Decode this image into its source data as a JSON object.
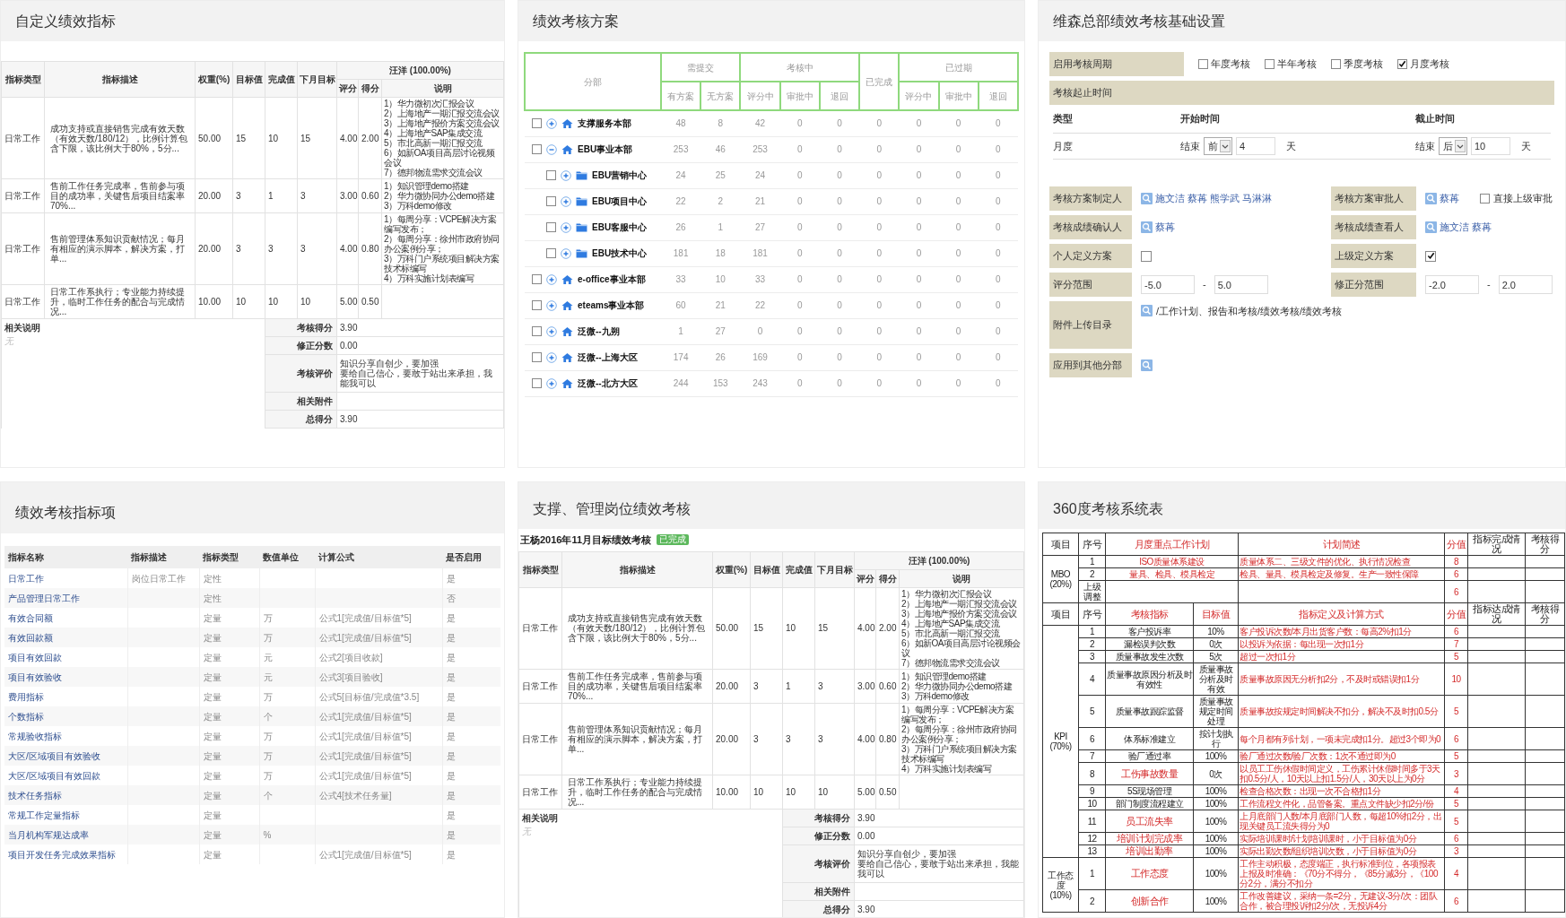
{
  "custom_indicators": {
    "title": "自定义绩效指标",
    "table": {
      "columns": [
        "指标类型",
        "指标描述",
        "权重(%)",
        "目标值",
        "完成值",
        "下月目标"
      ],
      "reviewer": "汪洋 (100.00%)",
      "sub_columns": [
        "评分",
        "得分",
        "说明"
      ],
      "rows": [
        {
          "type": "日常工作",
          "description": "成功支持或直接销售完成有效天数（有效天数/180/12），比例计算包含下限，该比例大于80%，5分...",
          "weight": "50.00",
          "target": "15",
          "actual": "10",
          "next_target": "15",
          "rating": "4.00",
          "score": "2.00",
          "notes": [
            "1）华力微初次汇报会议",
            "2）上海地产一期汇报交流会议",
            "3）上海地产报价方案交流会议",
            "4）上海地产SAP集成交流",
            "5）市北高新一期汇报交流",
            "6）如新OA项目高层讨论视频会议",
            "7）德邦物流需求交流会议"
          ]
        },
        {
          "type": "日常工作",
          "description": "售前工作任务完成率，售前参与项目的成功率，关键售后项目结案率70%...",
          "weight": "20.00",
          "target": "3",
          "actual": "1",
          "next_target": "3",
          "rating": "3.00",
          "score": "0.60",
          "notes": [
            "1）知识管理demo搭建",
            "2）华力微协同办公demo搭建",
            "3）万科demo修改"
          ]
        },
        {
          "type": "日常工作",
          "description": "售前管理体系知识贡献情况；每月有相应的演示脚本，解决方案，打单...",
          "weight": "20.00",
          "target": "3",
          "actual": "3",
          "next_target": "3",
          "rating": "4.00",
          "score": "0.80",
          "notes": [
            "1）每周分享：VCPE解决方案编写发布；",
            "2）每周分享：徐州市政府协同办公案例分享；",
            "3）万科门户系统项目解决方案技术标编写",
            "4）万科实施计划表编写"
          ]
        },
        {
          "type": "日常工作",
          "description": "日常工作系执行；专业能力持续提升，临时工作任务的配合与完成情况...",
          "weight": "10.00",
          "target": "10",
          "actual": "10",
          "next_target": "10",
          "rating": "5.00",
          "score": "0.50"
        }
      ],
      "remarks_label": "相关说明",
      "remarks": "无",
      "summary": [
        {
          "label": "考核得分",
          "value": "3.90"
        },
        {
          "label": "修正分数",
          "value": "0.00"
        },
        {
          "label": "考核评价",
          "lines": [
            "知识分享自创少，要加强",
            "要给自己信心，要敢于站出来承担，我能我可以"
          ]
        },
        {
          "label": "相关附件"
        },
        {
          "label": "总得分",
          "value": "3.90"
        }
      ]
    }
  },
  "assessment_plans": {
    "title": "绩效考核方案",
    "columns": [
      {
        "label": "分部"
      },
      {
        "label": "需提交",
        "sub": [
          "有方案",
          "无方案"
        ]
      },
      {
        "label": "考核中",
        "sub": [
          "评分中",
          "审批中",
          "退回"
        ]
      },
      {
        "label": "已完成"
      },
      {
        "label": "已过期",
        "sub": [
          "评分中",
          "审批中",
          "退回"
        ]
      }
    ],
    "rows": [
      {
        "name": "支撑服务本部",
        "checked": false,
        "expanded": false,
        "values": [
          "48",
          "8",
          "42",
          "0",
          "0",
          "0",
          "0",
          "0",
          "0"
        ]
      },
      {
        "name": "EBU事业本部",
        "checked": false,
        "expanded": true,
        "values": [
          "253",
          "46",
          "253",
          "0",
          "0",
          "0",
          "0",
          "0",
          "0"
        ],
        "children": [
          {
            "name": "EBU营销中心",
            "checked": false,
            "expanded": false,
            "values": [
              "24",
              "25",
              "24",
              "0",
              "0",
              "0",
              "0",
              "0",
              "0"
            ]
          },
          {
            "name": "EBU项目中心",
            "checked": false,
            "expanded": false,
            "values": [
              "22",
              "2",
              "21",
              "0",
              "0",
              "0",
              "0",
              "0",
              "0"
            ]
          },
          {
            "name": "EBU客服中心",
            "checked": false,
            "expanded": false,
            "values": [
              "26",
              "1",
              "27",
              "0",
              "0",
              "0",
              "0",
              "0",
              "0"
            ]
          },
          {
            "name": "EBU技术中心",
            "checked": false,
            "expanded": false,
            "values": [
              "181",
              "18",
              "181",
              "0",
              "0",
              "0",
              "0",
              "0",
              "0"
            ]
          }
        ]
      },
      {
        "name": "e-office事业本部",
        "checked": false,
        "expanded": false,
        "values": [
          "33",
          "10",
          "33",
          "0",
          "0",
          "0",
          "0",
          "0",
          "0"
        ]
      },
      {
        "name": "eteams事业本部",
        "checked": false,
        "expanded": false,
        "values": [
          "60",
          "21",
          "22",
          "0",
          "0",
          "0",
          "0",
          "0",
          "0"
        ]
      },
      {
        "name": "泛微--九朔",
        "checked": false,
        "expanded": false,
        "values": [
          "1",
          "27",
          "0",
          "0",
          "0",
          "0",
          "0",
          "0",
          "0"
        ]
      },
      {
        "name": "泛微--上海大区",
        "checked": false,
        "expanded": false,
        "values": [
          "174",
          "26",
          "169",
          "0",
          "0",
          "0",
          "0",
          "0",
          "0"
        ]
      },
      {
        "name": "泛微--北方大区",
        "checked": false,
        "expanded": false,
        "values": [
          "244",
          "153",
          "243",
          "0",
          "0",
          "0",
          "0",
          "0",
          "0"
        ]
      }
    ]
  },
  "basic_settings": {
    "title": "维森总部绩效考核基础设置",
    "cycle": {
      "label": "启用考核周期",
      "options": [
        {
          "label": "年度考核",
          "checked": false
        },
        {
          "label": "半年考核",
          "checked": false
        },
        {
          "label": "季度考核",
          "checked": false
        },
        {
          "label": "月度考核",
          "checked": true
        }
      ]
    },
    "period_label": "考核起止时间",
    "period_columns": [
      "类型",
      "开始时间",
      "截止时间"
    ],
    "period_rows": [
      {
        "type": "月度",
        "start": {
          "prefix": "结束",
          "direction": "前",
          "days": "4",
          "unit": "天"
        },
        "end": {
          "prefix": "结束",
          "direction": "后",
          "days": "10",
          "unit": "天"
        }
      }
    ],
    "fields": [
      [
        {
          "label": "考核方案制定人",
          "kind": "people",
          "people": [
            "施文洁",
            "蔡苒",
            "熊学武",
            "马淋淋"
          ]
        },
        {
          "label": "考核方案审批人",
          "kind": "people",
          "people": [
            "蔡苒"
          ],
          "option": {
            "label": "直接上级审批",
            "checked": false
          }
        }
      ],
      [
        {
          "label": "考核成绩确认人",
          "kind": "people",
          "people": [
            "蔡苒"
          ]
        },
        {
          "label": "考核成绩查看人",
          "kind": "people",
          "people": [
            "施文洁",
            "蔡苒"
          ]
        }
      ],
      [
        {
          "label": "个人定义方案",
          "kind": "checkbox",
          "checked": false
        },
        {
          "label": "上级定义方案",
          "kind": "checkbox",
          "checked": true
        }
      ],
      [
        {
          "label": "评分范围",
          "kind": "range",
          "from": "-5.0",
          "separator": "-",
          "to": "5.0"
        },
        {
          "label": "修正分范围",
          "kind": "range",
          "from": "-2.0",
          "separator": "-",
          "to": "2.0"
        }
      ],
      [
        {
          "label": "附件上传目录",
          "kind": "path",
          "path": "/工作计划、报告和考核/绩效考核/绩效考核"
        }
      ],
      [
        {
          "label": "应用到其他分部",
          "kind": "lookup"
        }
      ]
    ]
  },
  "indicator_items": {
    "title": "绩效考核指标项",
    "columns": [
      "指标名称",
      "指标描述",
      "指标类型",
      "数值单位",
      "计算公式",
      "是否启用"
    ],
    "rows": [
      {
        "name": "日常工作",
        "description": "岗位日常工作",
        "type": "定性",
        "enabled": "是"
      },
      {
        "name": "产品管理日常工作",
        "type": "定性",
        "enabled": "否"
      },
      {
        "name": "有效合同额",
        "type": "定量",
        "unit": "万",
        "formula": "公式1[完成值/目标值*5]",
        "enabled": "是"
      },
      {
        "name": "有效回款额",
        "type": "定量",
        "unit": "万",
        "formula": "公式1[完成值/目标值*5]",
        "enabled": "是"
      },
      {
        "name": "项目有效回款",
        "type": "定量",
        "unit": "元",
        "formula": "公式2[项目收款]",
        "enabled": "是"
      },
      {
        "name": "项目有效验收",
        "type": "定量",
        "unit": "元",
        "formula": "公式3[项目验收]",
        "enabled": "是"
      },
      {
        "name": "费用指标",
        "type": "定量",
        "unit": "万",
        "formula": "公式5[目标值/完成值*3.5]",
        "enabled": "是"
      },
      {
        "name": "个数指标",
        "type": "定量",
        "unit": "个",
        "formula": "公式1[完成值/目标值*5]",
        "enabled": "是"
      },
      {
        "name": "常规验收指标",
        "type": "定量",
        "unit": "万",
        "formula": "公式1[完成值/目标值*5]",
        "enabled": "是"
      },
      {
        "name": "大区/区域项目有效验收",
        "type": "定量",
        "unit": "万",
        "formula": "公式1[完成值/目标值*5]",
        "enabled": "是"
      },
      {
        "name": "大区/区域项目有效回款",
        "type": "定量",
        "unit": "万",
        "formula": "公式1[完成值/目标值*5]",
        "enabled": "是"
      },
      {
        "name": "技术任务指标",
        "type": "定量",
        "unit": "个",
        "formula": "公式4[技术任务量]",
        "enabled": "是"
      },
      {
        "name": "常规工作定量指标",
        "type": "定量",
        "enabled": "是"
      },
      {
        "name": "当月机构军规达成率",
        "type": "定量",
        "unit": "%",
        "enabled": "是"
      },
      {
        "name": "项目开发任务完成效果指标",
        "type": "定量",
        "formula": "公式1[完成值/目标值*5]",
        "enabled": "是"
      }
    ]
  },
  "post_assessment": {
    "title": "支撑、管理岗位绩效考核",
    "subtitle": "王杨2016年11月目标绩效考核",
    "badge": "已完成",
    "table": {
      "columns": [
        "指标类型",
        "指标描述",
        "权重(%)",
        "目标值",
        "完成值",
        "下月目标"
      ],
      "reviewer": "汪洋 (100.00%)",
      "sub_columns": [
        "评分",
        "得分",
        "说明"
      ],
      "rows": [
        {
          "type": "日常工作",
          "description": "成功支持或直接销售完成有效天数（有效天数/180/12），比例计算包含下限，该比例大于80%，5分...",
          "weight": "50.00",
          "target": "15",
          "actual": "10",
          "next_target": "15",
          "rating": "4.00",
          "score": "2.00",
          "notes": [
            "1）华力微初次汇报会议",
            "2）上海地产一期汇报交流会议",
            "3）上海地产报价方案交流会议",
            "4）上海地产SAP集成交流",
            "5）市北高新一期汇报交流",
            "6）如新OA项目高层讨论视频会议",
            "7）德邦物流需求交流会议"
          ]
        },
        {
          "type": "日常工作",
          "description": "售前工作任务完成率，售前参与项目的成功率，关键售后项目结案率70%...",
          "weight": "20.00",
          "target": "3",
          "actual": "1",
          "next_target": "3",
          "rating": "3.00",
          "score": "0.60",
          "notes": [
            "1）知识管理demo搭建",
            "2）华力微协同办公demo搭建",
            "3）万科demo修改"
          ]
        },
        {
          "type": "日常工作",
          "description": "售前管理体系知识贡献情况；每月有相应的演示脚本，解决方案，打单...",
          "weight": "20.00",
          "target": "3",
          "actual": "3",
          "next_target": "3",
          "rating": "4.00",
          "score": "0.80",
          "notes": [
            "1）每周分享：VCPE解决方案编写发布；",
            "2）每周分享：徐州市政府协同办公案例分享；",
            "3）万科门户系统项目解决方案技术标编写",
            "4）万科实施计划表编写"
          ]
        },
        {
          "type": "日常工作",
          "description": "日常工作系执行；专业能力持续提升，临时工作任务的配合与完成情况...",
          "weight": "10.00",
          "target": "10",
          "actual": "10",
          "next_target": "10",
          "rating": "5.00",
          "score": "0.50"
        }
      ],
      "remarks_label": "相关说明",
      "remarks": "无",
      "summary": [
        {
          "label": "考核得分",
          "value": "3.90"
        },
        {
          "label": "修正分数",
          "value": "0.00"
        },
        {
          "label": "考核评价",
          "lines": [
            "知识分享自创少，要加强",
            "要给自己信心，要敢于站出来承担，我能我可以"
          ]
        },
        {
          "label": "相关附件"
        },
        {
          "label": "总得分",
          "value": "3.90"
        }
      ]
    }
  },
  "table_360": {
    "title": "360度考核系统表",
    "mbo_header": [
      {
        "text": "项目",
        "highlight": false
      },
      {
        "text": "序号",
        "highlight": false
      },
      {
        "text": "月度重点工作计划",
        "highlight": true
      },
      {
        "text": "计划简述",
        "highlight": true
      },
      {
        "text": "分值",
        "highlight": true
      },
      {
        "text": "指标完成情况",
        "highlight": false
      },
      {
        "text": "考核得分",
        "highlight": false
      }
    ],
    "mbo": {
      "label": "MBO\n(20%)",
      "rows": [
        {
          "no": "1",
          "plan": "ISO质量体系建设",
          "brief": "质量体系二、三级文件的优化、执行情况检查",
          "points": "8"
        },
        {
          "no": "2",
          "plan": "量具、检具、模具检定",
          "brief": "检具、量具、模具检定及修复。生产一致性保障",
          "points": "6"
        },
        {
          "no": "上级调整",
          "points": "6"
        }
      ]
    },
    "kpi_header": [
      {
        "text": "项目",
        "highlight": false
      },
      {
        "text": "序号",
        "highlight": false
      },
      {
        "text": "考核指标",
        "highlight": true
      },
      {
        "text": "目标值",
        "highlight": true
      },
      {
        "text": "指标定义及计算方式",
        "highlight": true
      },
      {
        "text": "分值",
        "highlight": true
      },
      {
        "text": "指标达成情况",
        "highlight": false
      },
      {
        "text": "考核得分",
        "highlight": false
      }
    ],
    "sections": [
      {
        "label": "KPI\n(70%)",
        "rows": [
          {
            "no": "1",
            "name": "客户投诉率",
            "highlight": false,
            "target": "10%",
            "definition": "客户投诉次数/本月出货客户数：每高2%扣1分",
            "points": "6"
          },
          {
            "no": "2",
            "name": "漏检误判次数",
            "highlight": false,
            "target": "0次",
            "definition": "以投诉为依据：每出现一次扣1分",
            "points": "7"
          },
          {
            "no": "3",
            "name": "质量事故发生次数",
            "highlight": false,
            "target": "5次",
            "definition": "超过一次扣1分",
            "points": "5"
          },
          {
            "no": "4",
            "name": "质量事故原因分析及时有效性",
            "highlight": false,
            "target": "质量事故分析及时有效",
            "definition": "质量事故原因无分析扣2分，不及时或错误扣1分",
            "points": "10"
          },
          {
            "no": "5",
            "name": "质量事故跟踪监督",
            "highlight": false,
            "target": "质量事故规定时间处理",
            "definition": "质量事故按规定时间解决不扣分，解决不及时扣0.5分",
            "points": "5"
          },
          {
            "no": "6",
            "name": "体系标准建立",
            "highlight": false,
            "target": "按计划执行",
            "definition": "每个月都有列计划，一项未完成扣1分。超过3个即为0",
            "points": "6"
          },
          {
            "no": "7",
            "name": "验厂通过率",
            "highlight": false,
            "target": "100%",
            "definition": "验厂通过次数/验厂次数：1次不通过即为0",
            "points": "5"
          },
          {
            "no": "8",
            "name": "工伤事故数量",
            "highlight": true,
            "target": "0次",
            "definition": "以员工工伤休假时间定义，工伤累计休假时间多于3天扣0.5分/人，10天以上扣1.5分/人，30天以上为0分",
            "points": "3"
          },
          {
            "no": "9",
            "name": "5S现场管理",
            "highlight": false,
            "target": "100%",
            "definition": "检查合格次数：出现一次不合格扣1分",
            "points": "4"
          },
          {
            "no": "10",
            "name": "部门制度流程建立",
            "highlight": false,
            "target": "100%",
            "definition": "工作流程文件化，品管备案。重点文件缺少扣2分/份",
            "points": "5"
          },
          {
            "no": "11",
            "name": "员工流失率",
            "highlight": true,
            "target": "100%",
            "definition": "上月底部门人数/本月底部门人数，每超10%扣2分，出现关键员工流失得分为0",
            "points": "5"
          },
          {
            "no": "12",
            "name": "培训计划完成率",
            "highlight": true,
            "target": "100%",
            "definition": "实际培训课时/计划培训课时，小于目标值为0分",
            "points": "6"
          },
          {
            "no": "13",
            "name": "培训出勤率",
            "highlight": true,
            "target": "100%",
            "definition": "实际出勤次数/组织培训次数，小于目标值为0分",
            "points": "3"
          }
        ]
      },
      {
        "label": "工作态度\n(10%)",
        "rows": [
          {
            "no": "1",
            "name": "工作态度",
            "highlight": true,
            "target": "100%",
            "definition": "工作主动积极，态度端正，执行标准到位，各项报表上报及时准确：《70分不得分，《85分减3分，《100分2分，满分不扣分",
            "points": "4"
          },
          {
            "no": "2",
            "name": "创新合作",
            "highlight": true,
            "target": "100%",
            "definition": "工作改善建议，采纳一条=2分，无建议-3分/次：团队合作，被合理投诉扣2分/次，无投诉4分",
            "points": "6"
          }
        ]
      }
    ]
  }
}
